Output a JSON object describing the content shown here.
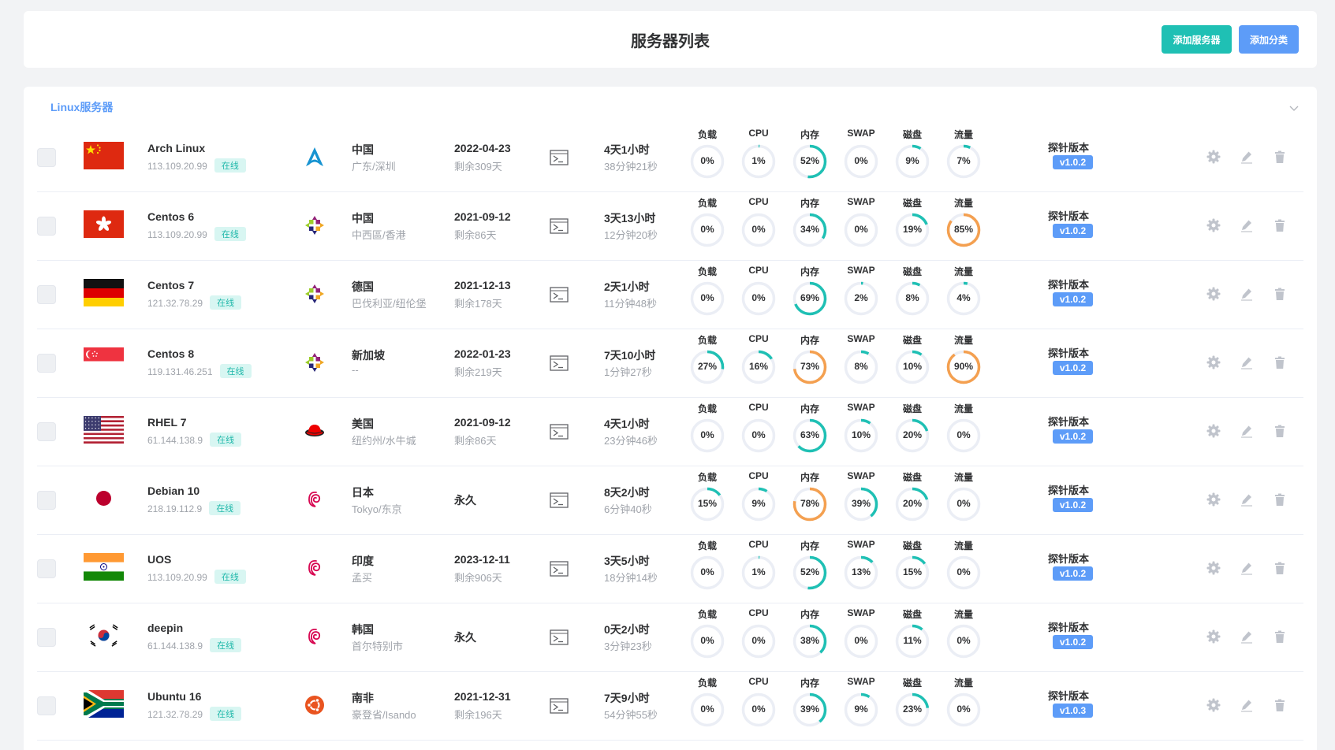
{
  "header": {
    "title": "服务器列表",
    "add_server_label": "添加服务器",
    "add_category_label": "添加分类"
  },
  "category": {
    "title": "Linux服务器"
  },
  "metric_labels": [
    "负载",
    "CPU",
    "内存",
    "SWAP",
    "磁盘",
    "流量"
  ],
  "probe_label": "探针版本",
  "status_online": "在线",
  "colors": {
    "teal": "#1fc0b4",
    "orange": "#f4a050",
    "blue": "#5d9cf8",
    "ring_track": "#ebeef5"
  },
  "servers": [
    {
      "name": "Arch Linux",
      "ip": "113.109.20.99",
      "status": "在线",
      "flag": "cn",
      "os": "arch",
      "country": "中国",
      "region": "广东/深圳",
      "date": "2022-04-23",
      "remain": "剩余309天",
      "uptime1": "4天1小时",
      "uptime2": "38分钟21秒",
      "metrics": [
        0,
        1,
        52,
        0,
        9,
        7
      ],
      "version": "v1.0.2"
    },
    {
      "name": "Centos 6",
      "ip": "113.109.20.99",
      "status": "在线",
      "flag": "hk",
      "os": "centos",
      "country": "中国",
      "region": "中西區/香港",
      "date": "2021-09-12",
      "remain": "剩余86天",
      "uptime1": "3天13小时",
      "uptime2": "12分钟20秒",
      "metrics": [
        0,
        0,
        34,
        0,
        19,
        85
      ],
      "version": "v1.0.2"
    },
    {
      "name": "Centos 7",
      "ip": "121.32.78.29",
      "status": "在线",
      "flag": "de",
      "os": "centos",
      "country": "德国",
      "region": "巴伐利亚/纽伦堡",
      "date": "2021-12-13",
      "remain": "剩余178天",
      "uptime1": "2天1小时",
      "uptime2": "11分钟48秒",
      "metrics": [
        0,
        0,
        69,
        2,
        8,
        4
      ],
      "version": "v1.0.2"
    },
    {
      "name": "Centos 8",
      "ip": "119.131.46.251",
      "status": "在线",
      "flag": "sg",
      "os": "centos",
      "country": "新加坡",
      "region": "--",
      "date": "2022-01-23",
      "remain": "剩余219天",
      "uptime1": "7天10小时",
      "uptime2": "1分钟27秒",
      "metrics": [
        27,
        16,
        73,
        8,
        10,
        90
      ],
      "version": "v1.0.2"
    },
    {
      "name": "RHEL 7",
      "ip": "61.144.138.9",
      "status": "在线",
      "flag": "us",
      "os": "redhat",
      "country": "美国",
      "region": "纽约州/水牛城",
      "date": "2021-09-12",
      "remain": "剩余86天",
      "uptime1": "4天1小时",
      "uptime2": "23分钟46秒",
      "metrics": [
        0,
        0,
        63,
        10,
        20,
        0
      ],
      "version": "v1.0.2"
    },
    {
      "name": "Debian 10",
      "ip": "218.19.112.9",
      "status": "在线",
      "flag": "jp",
      "os": "debian",
      "country": "日本",
      "region": "Tokyo/东京",
      "date": "永久",
      "remain": "",
      "uptime1": "8天2小时",
      "uptime2": "6分钟40秒",
      "metrics": [
        15,
        9,
        78,
        39,
        20,
        0
      ],
      "version": "v1.0.2"
    },
    {
      "name": "UOS",
      "ip": "113.109.20.99",
      "status": "在线",
      "flag": "in",
      "os": "debian",
      "country": "印度",
      "region": "孟买",
      "date": "2023-12-11",
      "remain": "剩余906天",
      "uptime1": "3天5小时",
      "uptime2": "18分钟14秒",
      "metrics": [
        0,
        1,
        52,
        13,
        15,
        0
      ],
      "version": "v1.0.2"
    },
    {
      "name": "deepin",
      "ip": "61.144.138.9",
      "status": "在线",
      "flag": "kr",
      "os": "debian",
      "country": "韩国",
      "region": "首尔特别市",
      "date": "永久",
      "remain": "",
      "uptime1": "0天2小时",
      "uptime2": "3分钟23秒",
      "metrics": [
        0,
        0,
        38,
        0,
        11,
        0
      ],
      "version": "v1.0.2"
    },
    {
      "name": "Ubuntu 16",
      "ip": "121.32.78.29",
      "status": "在线",
      "flag": "za",
      "os": "ubuntu",
      "country": "南非",
      "region": "豪登省/Isando",
      "date": "2021-12-31",
      "remain": "剩余196天",
      "uptime1": "7天9小时",
      "uptime2": "54分钟55秒",
      "metrics": [
        0,
        0,
        39,
        9,
        23,
        0
      ],
      "version": "v1.0.3"
    }
  ]
}
